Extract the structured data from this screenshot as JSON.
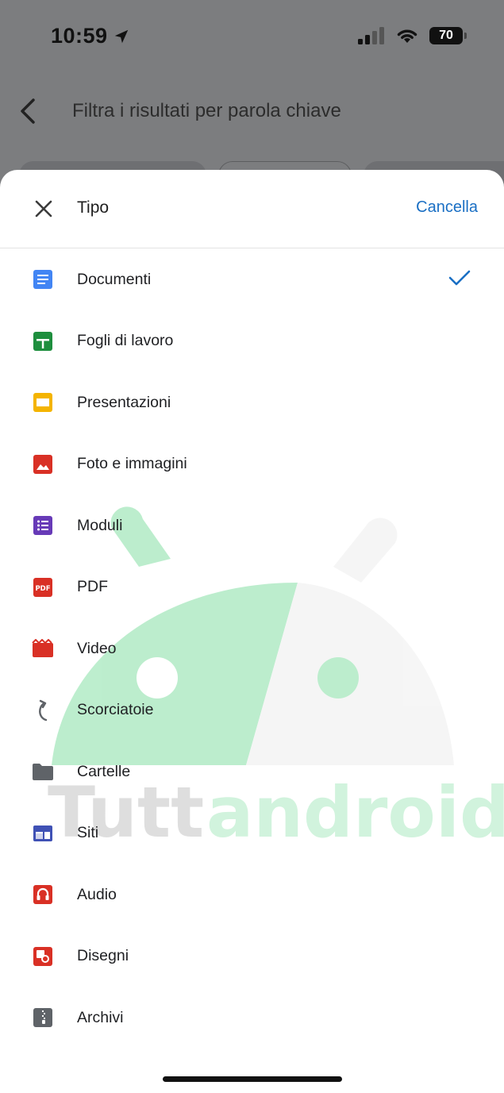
{
  "status_bar": {
    "time": "10:59",
    "battery": "70"
  },
  "search": {
    "placeholder": "Filtra i risultati per parola chiave"
  },
  "sheet": {
    "title": "Tipo",
    "cancel_label": "Cancella",
    "items": [
      {
        "label": "Documenti",
        "icon": "docs-icon",
        "color": "#4285f4",
        "selected": true
      },
      {
        "label": "Fogli di lavoro",
        "icon": "sheets-icon",
        "color": "#1e8e3e"
      },
      {
        "label": "Presentazioni",
        "icon": "slides-icon",
        "color": "#f4b400"
      },
      {
        "label": "Foto e immagini",
        "icon": "image-icon",
        "color": "#d93025"
      },
      {
        "label": "Moduli",
        "icon": "forms-icon",
        "color": "#673ab7"
      },
      {
        "label": "PDF",
        "icon": "pdf-icon",
        "color": "#d93025"
      },
      {
        "label": "Video",
        "icon": "video-icon",
        "color": "#d93025"
      },
      {
        "label": "Scorciatoie",
        "icon": "shortcut-icon",
        "color": "#5f6368"
      },
      {
        "label": "Cartelle",
        "icon": "folder-icon",
        "color": "#5f6368"
      },
      {
        "label": "Siti",
        "icon": "sites-icon",
        "color": "#3f51b5"
      },
      {
        "label": "Audio",
        "icon": "audio-icon",
        "color": "#d93025"
      },
      {
        "label": "Disegni",
        "icon": "drawings-icon",
        "color": "#d93025"
      },
      {
        "label": "Archivi",
        "icon": "archive-icon",
        "color": "#5f6368"
      }
    ]
  },
  "colors": {
    "accent": "#1a6fc4",
    "scrim": "#7c7d7f"
  }
}
